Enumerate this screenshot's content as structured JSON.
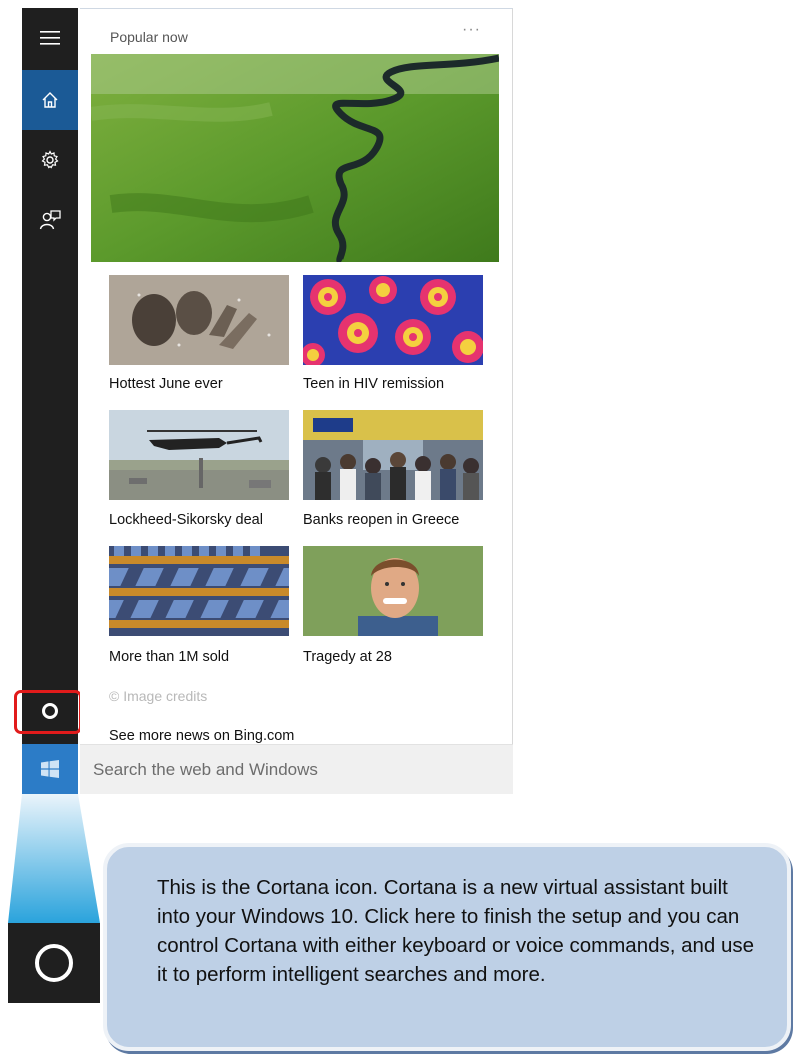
{
  "panel": {
    "title": "Popular now",
    "more_label": "···"
  },
  "rail": {
    "items": [
      {
        "icon": "hamburger-menu-icon"
      },
      {
        "icon": "home-icon",
        "active": true
      },
      {
        "icon": "gear-icon"
      },
      {
        "icon": "feedback-icon"
      }
    ]
  },
  "hero": {
    "image": "aerial river through green grassland"
  },
  "news": [
    {
      "caption": "Hottest June ever",
      "image": "people hands through wet glass"
    },
    {
      "caption": "Teen in HIV remission",
      "image": "colorful microscopic cells"
    },
    {
      "caption": "Lockheed-Sikorsky deal",
      "image": "helicopter over road"
    },
    {
      "caption": "Banks reopen in Greece",
      "image": "crowd outside bank"
    },
    {
      "caption": "More than 1M sold",
      "image": "stacks of boxed products"
    },
    {
      "caption": "Tragedy at 28",
      "image": "smiling man portrait"
    }
  ],
  "credits": "© Image credits",
  "see_more": "See more news on Bing.com",
  "search": {
    "placeholder": "Search the web and Windows"
  },
  "callout": {
    "text": "This is the Cortana icon. Cortana is a new virtual assistant built into your Windows 10. Click here to finish the setup and you can control Cortana with either keyboard or voice commands, and use it to perform intelligent searches and more."
  },
  "colors": {
    "rail_bg": "#1f1f1f",
    "home_active": "#1b5a96",
    "highlight_red": "#e11b1b",
    "callout_bg": "#bed0e6"
  }
}
